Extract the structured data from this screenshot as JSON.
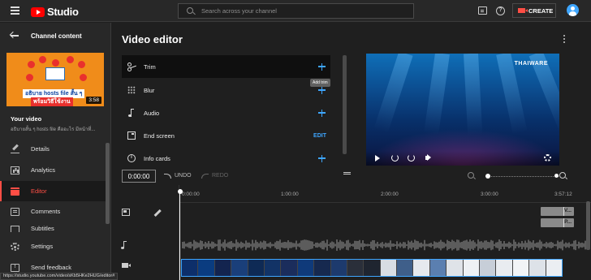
{
  "topbar": {
    "logo_text": "Studio",
    "search_placeholder": "Search across your channel",
    "create_label": "CREATE"
  },
  "sidebar": {
    "header_title": "Channel content",
    "thumbnail": {
      "caption_line1": "อธิบาย hosts file สั้น ๆ",
      "caption_line2": "พร้อมวิธีใช้งาน",
      "duration": "3:58"
    },
    "your_video_label": "Your video",
    "video_subtitle": "อธิบายสั้น ๆ hosts file คืออะไร มีหน้าที่...",
    "items": [
      {
        "label": "Details",
        "icon": "pencil-icon",
        "active": false
      },
      {
        "label": "Analytics",
        "icon": "analytics-icon",
        "active": false
      },
      {
        "label": "Editor",
        "icon": "editor-icon",
        "active": true
      },
      {
        "label": "Comments",
        "icon": "comments-icon",
        "active": false
      },
      {
        "label": "Subtitles",
        "icon": "subtitles-icon",
        "active": false
      },
      {
        "label": "Settings",
        "icon": "gear-icon",
        "active": false
      },
      {
        "label": "Send feedback",
        "icon": "feedback-icon",
        "active": false
      }
    ]
  },
  "main": {
    "title": "Video editor",
    "tools": [
      {
        "label": "Trim",
        "icon": "scissors-icon",
        "action": "plus"
      },
      {
        "label": "Blur",
        "icon": "blur-icon",
        "action": "plus"
      },
      {
        "label": "Audio",
        "icon": "music-note-icon",
        "action": "plus"
      },
      {
        "label": "End screen",
        "icon": "end-screen-icon",
        "action": "EDIT"
      },
      {
        "label": "Info cards",
        "icon": "info-icon",
        "action": "plus"
      }
    ],
    "tooltip": "Add trim",
    "player": {
      "brand": "THAIWARE"
    }
  },
  "timeline": {
    "timecode": "0:00:00",
    "undo_label": "UNDO",
    "redo_label": "REDO",
    "ruler_ticks": [
      "0:00:00",
      "1:00:00",
      "2:00:00",
      "3:00:00",
      "3:57:12"
    ],
    "zoom_level": 0,
    "end_screen_elements": [
      {
        "label": "V..."
      },
      {
        "label": "P..."
      }
    ]
  },
  "status_url": "https://studio.youtube.com/video/sKb5HKe2HUG/editor#",
  "colors": {
    "accent_red": "#ff4e45",
    "link_blue": "#3ea6ff",
    "brand_red": "#ff0000"
  }
}
